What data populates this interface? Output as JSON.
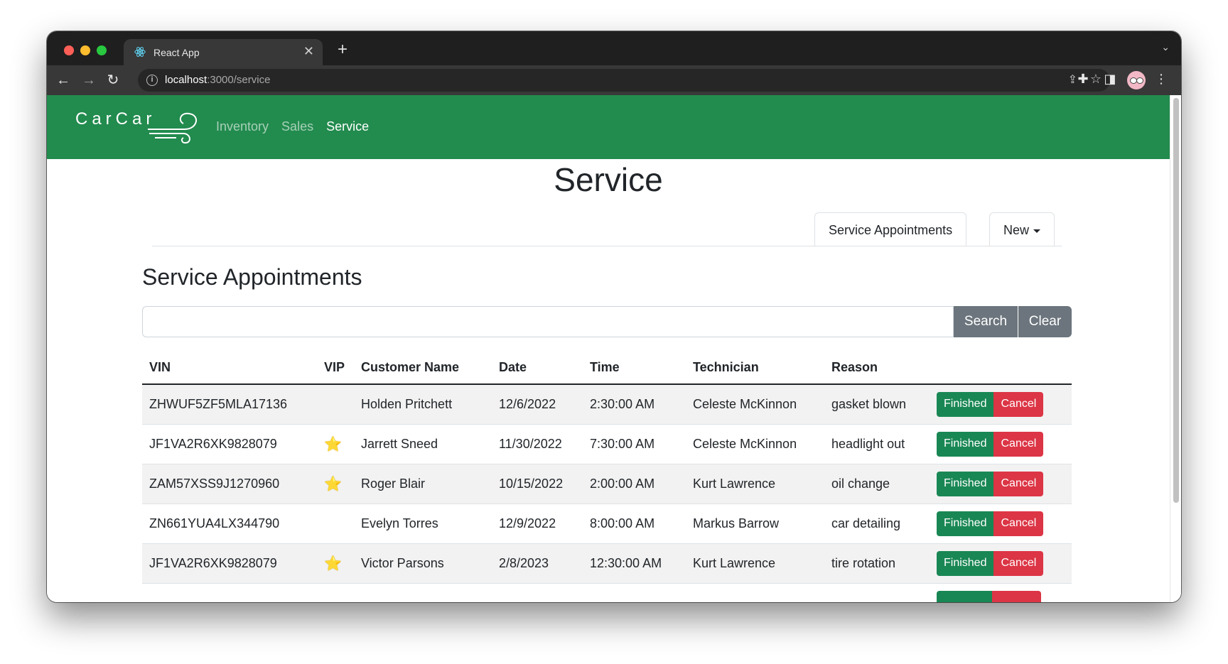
{
  "browser": {
    "tab_title": "React App",
    "tab_close": "✕",
    "new_tab": "+",
    "address_host": "localhost",
    "address_path": ":3000/service"
  },
  "app": {
    "brand": "CarCar",
    "nav": [
      {
        "label": "Inventory",
        "active": false
      },
      {
        "label": "Sales",
        "active": false
      },
      {
        "label": "Service",
        "active": true
      }
    ]
  },
  "page": {
    "title": "Service",
    "tabs": {
      "appointments": "Service Appointments",
      "new": "New"
    },
    "section_title": "Service Appointments",
    "search": {
      "value": "",
      "placeholder": "",
      "search_label": "Search",
      "clear_label": "Clear"
    }
  },
  "table": {
    "headers": [
      "VIN",
      "VIP",
      "Customer Name",
      "Date",
      "Time",
      "Technician",
      "Reason",
      ""
    ],
    "finished_label": "Finished",
    "cancel_label": "Cancel",
    "vip_icon": "⭐",
    "rows": [
      {
        "vin": "ZHWUF5ZF5MLA17136",
        "vip": "",
        "customer": "Holden Pritchett",
        "date": "12/6/2022",
        "time": "2:30:00 AM",
        "technician": "Celeste McKinnon",
        "reason": "gasket blown"
      },
      {
        "vin": "JF1VA2R6XK9828079",
        "vip": "⭐",
        "customer": "Jarrett Sneed",
        "date": "11/30/2022",
        "time": "7:30:00 AM",
        "technician": "Celeste McKinnon",
        "reason": "headlight out"
      },
      {
        "vin": "ZAM57XSS9J1270960",
        "vip": "⭐",
        "customer": "Roger Blair",
        "date": "10/15/2022",
        "time": "2:00:00 AM",
        "technician": "Kurt Lawrence",
        "reason": "oil change"
      },
      {
        "vin": "ZN661YUA4LX344790",
        "vip": "",
        "customer": "Evelyn Torres",
        "date": "12/9/2022",
        "time": "8:00:00 AM",
        "technician": "Markus Barrow",
        "reason": "car detailing"
      },
      {
        "vin": "JF1VA2R6XK9828079",
        "vip": "⭐",
        "customer": "Victor Parsons",
        "date": "2/8/2023",
        "time": "12:30:00 AM",
        "technician": "Kurt Lawrence",
        "reason": "tire rotation"
      }
    ]
  },
  "colors": {
    "navbar_green": "#228b4e",
    "finished_green": "#198754",
    "cancel_red": "#dc3545",
    "secondary_gray": "#6c757d"
  }
}
